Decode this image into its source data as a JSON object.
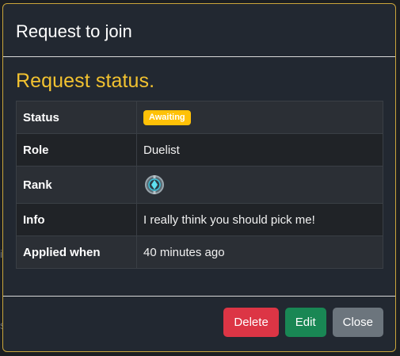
{
  "modal": {
    "title": "Request to join",
    "section_title": "Request status.",
    "rows": [
      {
        "label": "Status",
        "badge": "Awaiting"
      },
      {
        "label": "Role",
        "value": "Duelist"
      },
      {
        "label": "Rank",
        "icon": "rank-emblem-icon"
      },
      {
        "label": "Info",
        "value": "I really think you should pick me!"
      },
      {
        "label": "Applied when",
        "value": "40 minutes ago"
      }
    ],
    "buttons": {
      "delete": "Delete",
      "edit": "Edit",
      "close": "Close"
    }
  },
  "colors": {
    "accent": "#f2c230",
    "badge": "#ffc107",
    "danger": "#dc3545",
    "success": "#198754",
    "secondary": "#6c757d",
    "modal_bg": "#222831",
    "border": "#caa53a"
  }
}
